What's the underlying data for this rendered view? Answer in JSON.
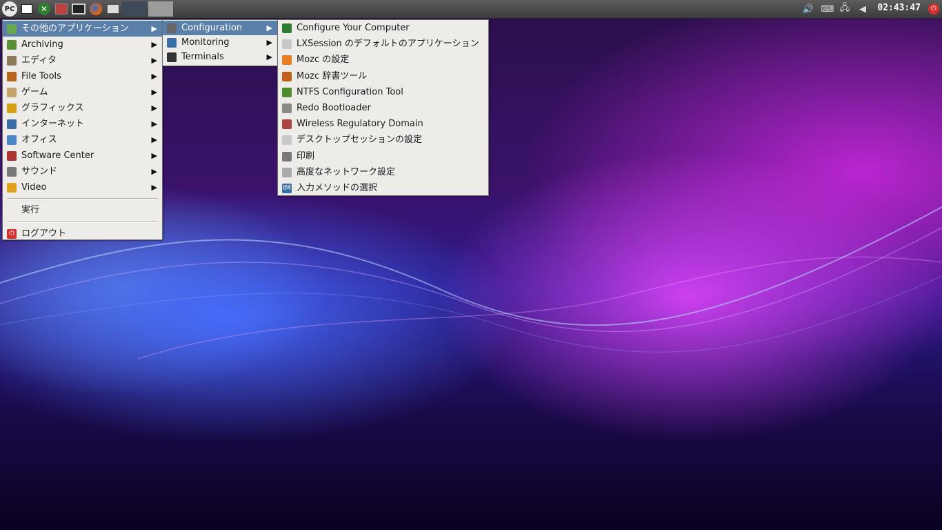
{
  "taskbar": {
    "clock": "02:43:47",
    "launchers": [
      "menu-icon",
      "show-desktop-icon",
      "xbox-icon",
      "network-tools-icon",
      "monitor-icon",
      "firefox-icon",
      "windows-icon"
    ],
    "start_label": "PC"
  },
  "main_menu": {
    "items": [
      {
        "label": "その他のアプリケーション",
        "icon": "apps-icon",
        "color": "#6aa84f",
        "submenu": true,
        "selected": true
      },
      {
        "label": "Archiving",
        "icon": "archive-icon",
        "color": "#5a8f3a",
        "submenu": true
      },
      {
        "label": "エディタ",
        "icon": "editor-icon",
        "color": "#8c7a5a",
        "submenu": true
      },
      {
        "label": "File Tools",
        "icon": "file-tools-icon",
        "color": "#b5651d",
        "submenu": true
      },
      {
        "label": "ゲーム",
        "icon": "game-icon",
        "color": "#c2a36b",
        "submenu": true
      },
      {
        "label": "グラフィックス",
        "icon": "graphics-icon",
        "color": "#d4a017",
        "submenu": true
      },
      {
        "label": "インターネット",
        "icon": "internet-icon",
        "color": "#3a6ea5",
        "submenu": true
      },
      {
        "label": "オフィス",
        "icon": "office-icon",
        "color": "#4a86c5",
        "submenu": true
      },
      {
        "label": "Software Center",
        "icon": "software-center-icon",
        "color": "#a33",
        "submenu": true
      },
      {
        "label": "サウンド",
        "icon": "sound-icon",
        "color": "#777",
        "submenu": true
      },
      {
        "label": "Video",
        "icon": "video-icon",
        "color": "#e0a020",
        "submenu": true
      }
    ],
    "run_label": "実行",
    "logout_label": "ログアウト"
  },
  "sub_menu": {
    "items": [
      {
        "label": "Configuration",
        "icon": "configuration-icon",
        "color": "#666",
        "submenu": true,
        "selected": true
      },
      {
        "label": "Monitoring",
        "icon": "monitoring-icon",
        "color": "#3a6ea5",
        "submenu": true
      },
      {
        "label": "Terminals",
        "icon": "terminal-icon",
        "color": "#333",
        "submenu": true
      }
    ]
  },
  "config_menu": {
    "items": [
      {
        "label": "Configure Your Computer",
        "icon": "xbox-icon",
        "color": "#2e7d32"
      },
      {
        "label": "LXSession のデフォルトのアプリケーション",
        "icon": "lxsession-icon",
        "color": "#c8c8c8"
      },
      {
        "label": "Mozc の設定",
        "icon": "gear-icon",
        "color": "#e67e22"
      },
      {
        "label": "Mozc 辞書ツール",
        "icon": "dictionary-icon",
        "color": "#c0601a"
      },
      {
        "label": "NTFS Configuration Tool",
        "icon": "ntfs-icon",
        "color": "#4c8c2c"
      },
      {
        "label": "Redo Bootloader",
        "icon": "tools-icon",
        "color": "#888"
      },
      {
        "label": "Wireless Regulatory Domain",
        "icon": "wireless-tools-icon",
        "color": "#a44"
      },
      {
        "label": "デスクトップセッションの設定",
        "icon": "session-icon",
        "color": "#c8c8c8"
      },
      {
        "label": "印刷",
        "icon": "printer-icon",
        "color": "#777"
      },
      {
        "label": "高度なネットワーク設定",
        "icon": "network-icon",
        "color": "#aaa"
      },
      {
        "label": "入力メソッドの選択",
        "icon": "input-method-icon",
        "color": "#3a6ea5",
        "glyph": "IM"
      }
    ]
  }
}
